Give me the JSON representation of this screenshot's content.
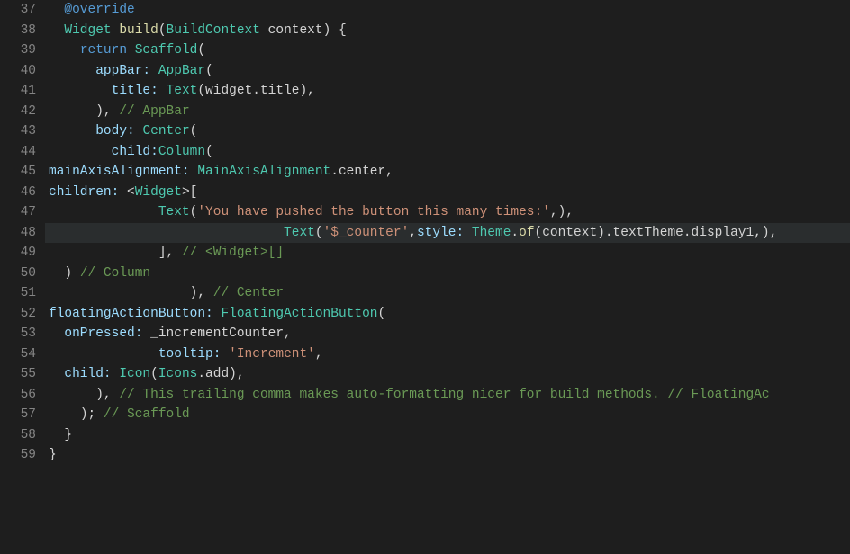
{
  "startLine": 37,
  "highlightedLine": 48,
  "bulbLine": 48,
  "lines": [
    {
      "n": 37,
      "indent": 2,
      "segs": [
        {
          "t": "@override",
          "c": "kw-blue"
        }
      ]
    },
    {
      "n": 38,
      "indent": 2,
      "segs": [
        {
          "t": "Widget",
          "c": "kw-teal"
        },
        {
          "t": " ",
          "c": "plain"
        },
        {
          "t": "build",
          "c": "fn"
        },
        {
          "t": "(",
          "c": "punct"
        },
        {
          "t": "BuildContext",
          "c": "kw-teal"
        },
        {
          "t": " context) {",
          "c": "plain"
        }
      ]
    },
    {
      "n": 39,
      "indent": 4,
      "segs": [
        {
          "t": "return",
          "c": "kw-blue"
        },
        {
          "t": " ",
          "c": "plain"
        },
        {
          "t": "Scaffold",
          "c": "kw-teal"
        },
        {
          "t": "(",
          "c": "punct"
        }
      ]
    },
    {
      "n": 40,
      "indent": 6,
      "segs": [
        {
          "t": "appBar: ",
          "c": "param"
        },
        {
          "t": "AppBar",
          "c": "kw-teal"
        },
        {
          "t": "(",
          "c": "punct"
        }
      ]
    },
    {
      "n": 41,
      "indent": 8,
      "segs": [
        {
          "t": "title: ",
          "c": "param"
        },
        {
          "t": "Text",
          "c": "kw-teal"
        },
        {
          "t": "(widget.title),",
          "c": "plain"
        }
      ]
    },
    {
      "n": 42,
      "indent": 6,
      "segs": [
        {
          "t": "), ",
          "c": "plain"
        },
        {
          "t": "// AppBar",
          "c": "comment"
        }
      ]
    },
    {
      "n": 43,
      "indent": 6,
      "segs": [
        {
          "t": "body: ",
          "c": "param"
        },
        {
          "t": "Center",
          "c": "kw-teal"
        },
        {
          "t": "(",
          "c": "punct"
        }
      ]
    },
    {
      "n": 44,
      "indent": 8,
      "segs": [
        {
          "t": "child:",
          "c": "param"
        },
        {
          "t": "Column",
          "c": "kw-teal"
        },
        {
          "t": "(",
          "c": "punct"
        }
      ]
    },
    {
      "n": 45,
      "indent": 0,
      "segs": [
        {
          "t": "mainAxisAlignment: ",
          "c": "param"
        },
        {
          "t": "MainAxisAlignment",
          "c": "kw-teal"
        },
        {
          "t": ".center,",
          "c": "plain"
        }
      ]
    },
    {
      "n": 46,
      "indent": 0,
      "segs": [
        {
          "t": "children: ",
          "c": "param"
        },
        {
          "t": "<",
          "c": "punct"
        },
        {
          "t": "Widget",
          "c": "kw-teal"
        },
        {
          "t": ">[",
          "c": "punct"
        }
      ]
    },
    {
      "n": 47,
      "indent": 14,
      "segs": [
        {
          "t": "Text",
          "c": "kw-teal"
        },
        {
          "t": "(",
          "c": "punct"
        },
        {
          "t": "'You have pushed the button this many times:'",
          "c": "str"
        },
        {
          "t": ",),",
          "c": "plain"
        }
      ]
    },
    {
      "n": 48,
      "indent": 30,
      "segs": [
        {
          "t": "Text",
          "c": "kw-teal"
        },
        {
          "t": "(",
          "c": "punct"
        },
        {
          "t": "'$_counter'",
          "c": "str"
        },
        {
          "t": ",",
          "c": "plain"
        },
        {
          "t": "style: ",
          "c": "param"
        },
        {
          "t": "Theme",
          "c": "kw-teal"
        },
        {
          "t": ".",
          "c": "plain"
        },
        {
          "t": "of",
          "c": "fn"
        },
        {
          "t": "(context).textTheme.display1,),",
          "c": "plain"
        }
      ]
    },
    {
      "n": 49,
      "indent": 14,
      "segs": [
        {
          "t": "], ",
          "c": "plain"
        },
        {
          "t": "// <Widget>[]",
          "c": "comment"
        }
      ]
    },
    {
      "n": 50,
      "indent": 2,
      "segs": [
        {
          "t": ") ",
          "c": "plain"
        },
        {
          "t": "// Column",
          "c": "comment"
        }
      ]
    },
    {
      "n": 51,
      "indent": 18,
      "segs": [
        {
          "t": "), ",
          "c": "plain"
        },
        {
          "t": "// Center",
          "c": "comment"
        }
      ]
    },
    {
      "n": 52,
      "indent": 0,
      "segs": [
        {
          "t": "floatingActionButton: ",
          "c": "param"
        },
        {
          "t": "FloatingActionButton",
          "c": "kw-teal"
        },
        {
          "t": "(",
          "c": "punct"
        }
      ]
    },
    {
      "n": 53,
      "indent": 2,
      "segs": [
        {
          "t": "onPressed: ",
          "c": "param"
        },
        {
          "t": "_incrementCounter,",
          "c": "plain"
        }
      ]
    },
    {
      "n": 54,
      "indent": 14,
      "segs": [
        {
          "t": "tooltip: ",
          "c": "param"
        },
        {
          "t": "'Increment'",
          "c": "str"
        },
        {
          "t": ",",
          "c": "plain"
        }
      ]
    },
    {
      "n": 55,
      "indent": 2,
      "segs": [
        {
          "t": "child: ",
          "c": "param"
        },
        {
          "t": "Icon",
          "c": "kw-teal"
        },
        {
          "t": "(",
          "c": "punct"
        },
        {
          "t": "Icons",
          "c": "kw-teal"
        },
        {
          "t": ".add),",
          "c": "plain"
        }
      ]
    },
    {
      "n": 56,
      "indent": 6,
      "segs": [
        {
          "t": "), ",
          "c": "plain"
        },
        {
          "t": "// This trailing comma makes auto-formatting nicer for build methods. // FloatingAc",
          "c": "comment"
        }
      ]
    },
    {
      "n": 57,
      "indent": 4,
      "segs": [
        {
          "t": "); ",
          "c": "plain"
        },
        {
          "t": "// Scaffold",
          "c": "comment"
        }
      ]
    },
    {
      "n": 58,
      "indent": 2,
      "segs": [
        {
          "t": "}",
          "c": "plain"
        }
      ]
    },
    {
      "n": 59,
      "indent": 0,
      "segs": [
        {
          "t": "}",
          "c": "plain"
        }
      ]
    }
  ]
}
